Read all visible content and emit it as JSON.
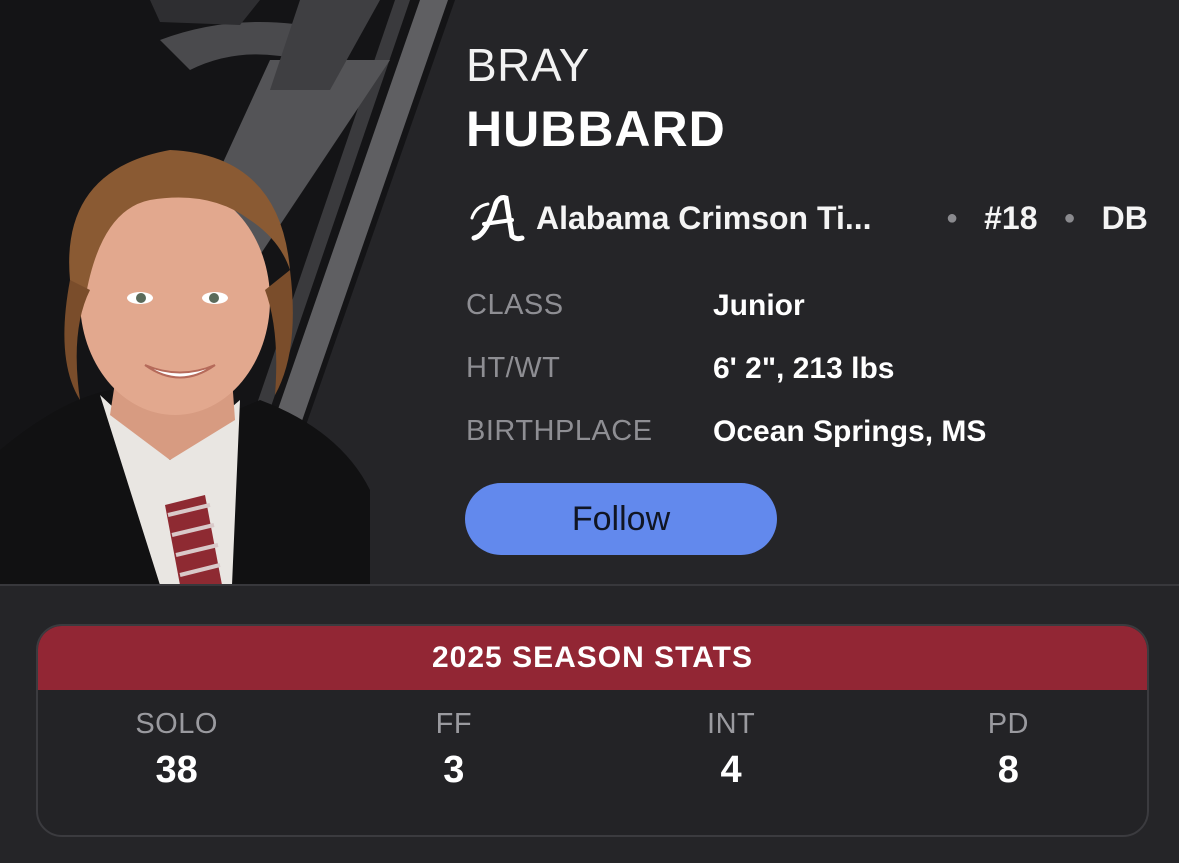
{
  "player": {
    "first_name": "BRAY",
    "last_name": "HUBBARD",
    "team": "Alabama Crimson Ti...",
    "team_logo": "script-a-logo",
    "number": "#18",
    "position": "DB"
  },
  "bio": [
    {
      "label": "CLASS",
      "value": "Junior"
    },
    {
      "label": "HT/WT",
      "value": "6' 2\", 213 lbs"
    },
    {
      "label": "BIRTHPLACE",
      "value": "Ocean Springs, MS"
    }
  ],
  "follow_label": "Follow",
  "stats": {
    "title": "2025 SEASON STATS",
    "items": [
      {
        "label": "SOLO",
        "value": "38"
      },
      {
        "label": "FF",
        "value": "3"
      },
      {
        "label": "INT",
        "value": "4"
      },
      {
        "label": "PD",
        "value": "8"
      }
    ]
  },
  "colors": {
    "background": "#252528",
    "accent": "#6289ed",
    "team_crimson": "#922634"
  }
}
